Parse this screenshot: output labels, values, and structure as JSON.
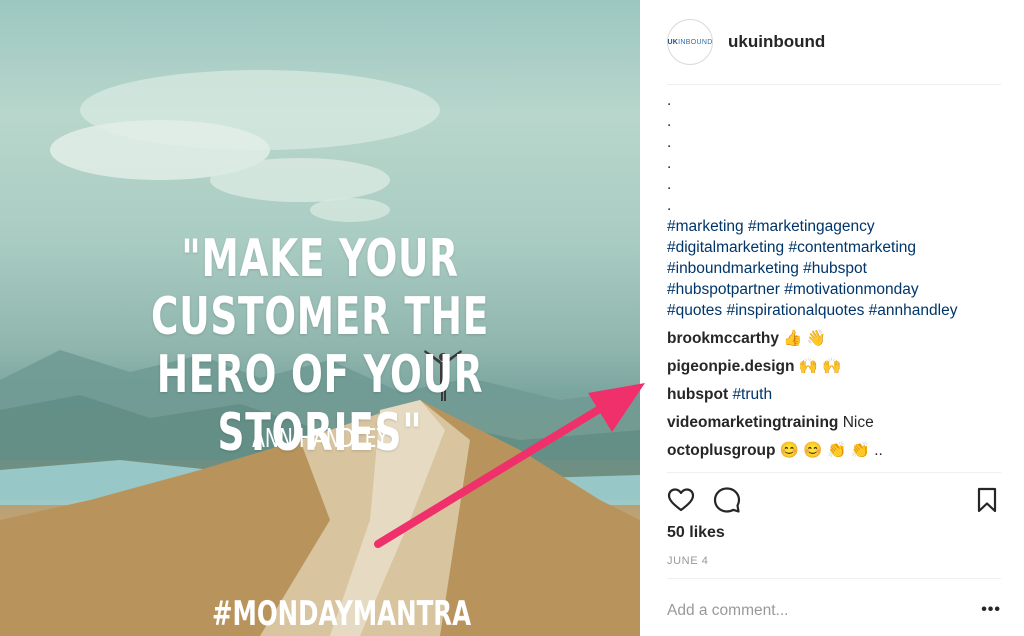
{
  "post_image": {
    "quote": "\"MAKE YOUR CUSTOMER THE HERO OF YOUR STORIES\"",
    "author": "ANN HANDLEY",
    "hashtag": "#MONDAYMANTRA"
  },
  "header": {
    "avatar_text": "UKUINBOUND",
    "avatar_text_prefix": "UK",
    "avatar_text_rest": "INBOUND",
    "username": "ukuinbound"
  },
  "caption": {
    "dots": [
      ".",
      ".",
      ".",
      ".",
      ".",
      "."
    ],
    "hashtags": [
      [
        "#marketing",
        "#marketingagency"
      ],
      [
        "#digitalmarketing",
        "#contentmarketing"
      ],
      [
        "#inboundmarketing",
        "#hubspot"
      ],
      [
        "#hubspotpartner",
        "#motivationmonday"
      ],
      [
        "#quotes",
        "#inspirationalquotes",
        "#annhandley"
      ]
    ]
  },
  "comments": [
    {
      "user": "brookmccarthy",
      "text": "👍 👋",
      "tag": ""
    },
    {
      "user": "pigeonpie.design",
      "text": "🙌 🙌",
      "tag": ""
    },
    {
      "user": "hubspot",
      "text": "",
      "tag": "#truth"
    },
    {
      "user": "videomarketingtraining",
      "text": "Nice",
      "tag": ""
    },
    {
      "user": "octoplusgroup",
      "text": "😊 😊 👏 👏 ..",
      "tag": ""
    }
  ],
  "actions": {
    "like_icon": "heart-icon",
    "comment_icon": "comment-bubble-icon",
    "save_icon": "bookmark-icon"
  },
  "likes": "50 likes",
  "date": "JUNE 4",
  "comment_box": {
    "placeholder": "Add a comment...",
    "more_label": "•••"
  },
  "colors": {
    "hashtag": "#003569",
    "text": "#262626",
    "muted": "#999999",
    "arrow": "#f0306a"
  }
}
